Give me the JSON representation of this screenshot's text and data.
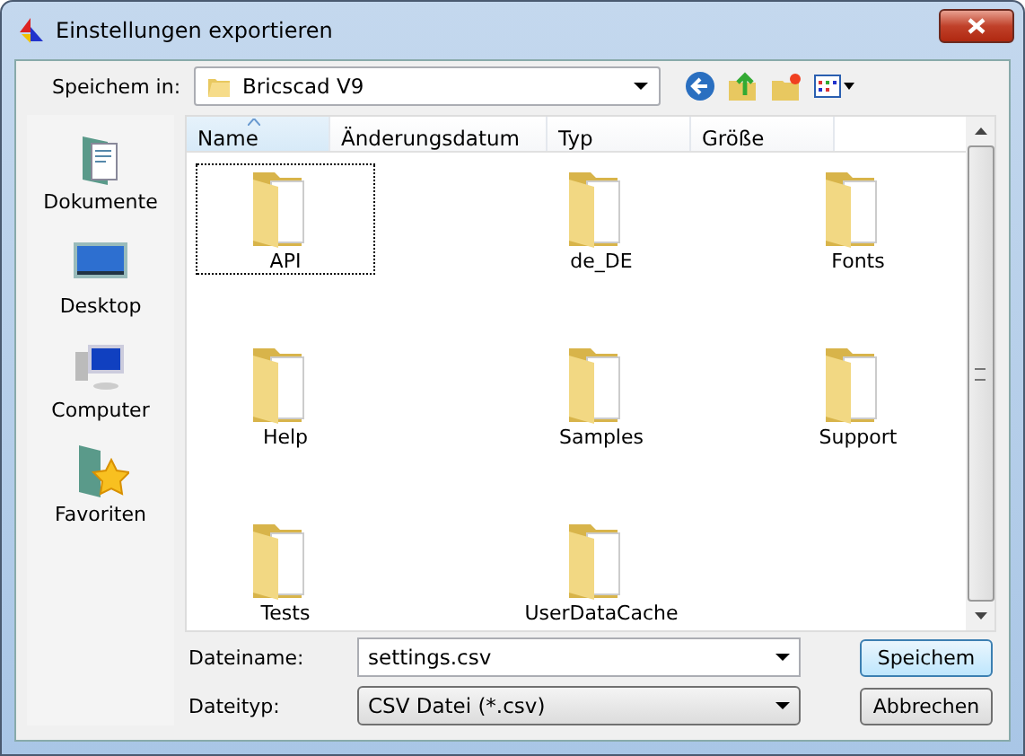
{
  "window": {
    "title": "Einstellungen exportieren"
  },
  "save_in": {
    "label": "Speichem in:",
    "value": "Bricscad V9"
  },
  "places": [
    {
      "label": "Dokumente",
      "kind": "documents"
    },
    {
      "label": "Desktop",
      "kind": "desktop"
    },
    {
      "label": "Computer",
      "kind": "computer"
    },
    {
      "label": "Favoriten",
      "kind": "favorites"
    }
  ],
  "columns": [
    {
      "label": "Name",
      "sorted": true
    },
    {
      "label": "Änderungsdatum",
      "sorted": false
    },
    {
      "label": "Typ",
      "sorted": false
    },
    {
      "label": "Größe",
      "sorted": false
    }
  ],
  "files": [
    {
      "name": "API",
      "selected": true
    },
    {
      "name": "de_DE",
      "selected": false
    },
    {
      "name": "Fonts",
      "selected": false
    },
    {
      "name": "Help",
      "selected": false
    },
    {
      "name": "Samples",
      "selected": false
    },
    {
      "name": "Support",
      "selected": false
    },
    {
      "name": "Tests",
      "selected": false
    },
    {
      "name": "UserDataCache",
      "selected": false
    }
  ],
  "file_name": {
    "label": "Dateiname:",
    "value": "settings.csv"
  },
  "file_type": {
    "label": "Dateityp:",
    "value": "CSV Datei (*.csv)"
  },
  "buttons": [
    {
      "label": "Speichem",
      "default": true
    },
    {
      "label": "Abbrechen",
      "default": false
    }
  ]
}
